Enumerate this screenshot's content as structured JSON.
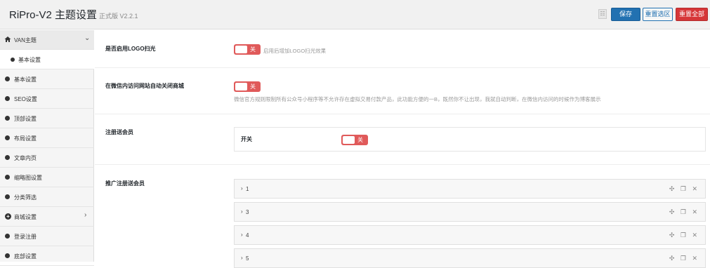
{
  "header": {
    "title": "RiPro-V2 主题设置",
    "version": "正式版 V2.2.1",
    "grid_icon": "grid-icon",
    "save_label": "保存",
    "reset_section_label": "重置选区",
    "reset_all_label": "重置全部"
  },
  "sidebar": {
    "parent": {
      "label": "VAN主题",
      "icon": "home-icon",
      "chevron": "⌄"
    },
    "items": [
      {
        "label": "基本设置"
      },
      {
        "label": "基本设置"
      },
      {
        "label": "SEO设置"
      },
      {
        "label": "顶部设置"
      },
      {
        "label": "布局设置"
      },
      {
        "label": "文章内页"
      },
      {
        "label": "缩略图设置"
      },
      {
        "label": "分类筛选"
      },
      {
        "label": "商城设置",
        "chevron": "›"
      },
      {
        "label": "登录注册"
      },
      {
        "label": "底部设置"
      }
    ]
  },
  "main": {
    "logo_scan": {
      "label": "是否启用LOGO扫光",
      "toggle": "关",
      "desc": "启用后增加LOGO扫光效果"
    },
    "wechat_close": {
      "label": "在微信内访问网站自动关闭商城",
      "toggle": "关",
      "desc": "微信官方规则限制所有公众号小程序等不允许存在虚拟交易付款产品，此功能方便的一B，既然你不让出现，我就自动判断，在微信内访问的时候作为博客展示"
    },
    "register_vip": {
      "label": "注册送会员",
      "switch_label": "开关",
      "toggle": "关"
    },
    "promo_vip": {
      "label": "推广注册送会员",
      "items": [
        {
          "title": "1"
        },
        {
          "title": "3"
        },
        {
          "title": "4"
        },
        {
          "title": "5"
        }
      ],
      "tool_icons": "✣ ❐ ✕"
    }
  },
  "colors": {
    "accent": "#2271b1",
    "danger": "#d63638",
    "toggle_off": "#e05a5a"
  }
}
